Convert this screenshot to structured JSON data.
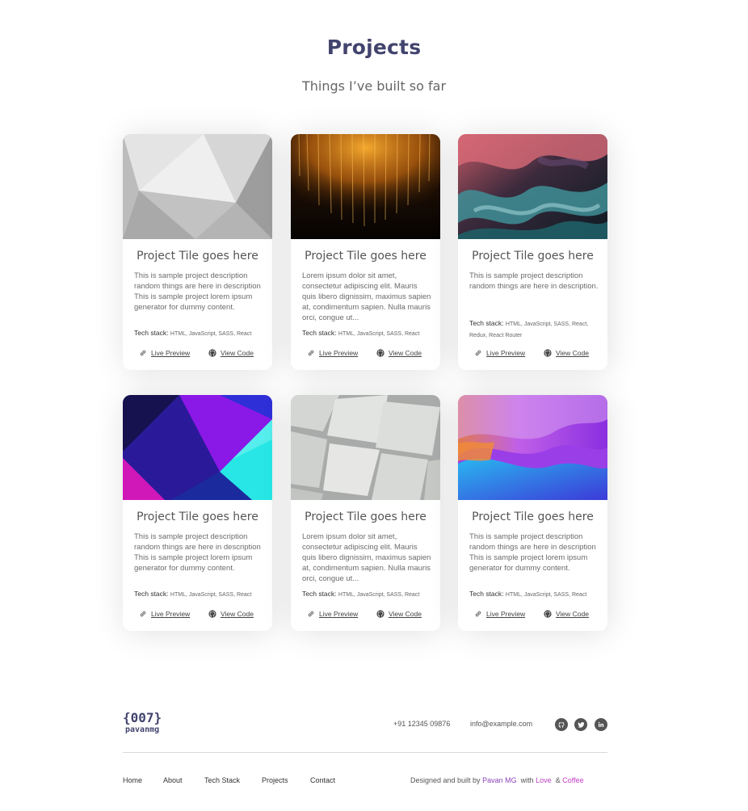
{
  "section": {
    "title": "Projects",
    "subtitle": "Things I’ve built so far"
  },
  "projects": [
    {
      "title": "Project Tile goes here",
      "description": "This is sample project description random things are here in description This is sample project lorem ipsum generator for dummy content.",
      "stack_label": "Tech stack:",
      "stack": "HTML, JavaScript, SASS, React",
      "live_label": "Live Preview",
      "code_label": "View Code",
      "image": "grey-geometric-image"
    },
    {
      "title": "Project Tile goes here",
      "description": "Lorem ipsum dolor sit amet, consectetur adipiscing elit. Mauris quis libero dignissim, maximus sapien at, condimentum sapien. Nulla mauris orci, congue ut...",
      "stack_label": "Tech stack:",
      "stack": "HTML, JavaScript, SASS, React",
      "live_label": "Live Preview",
      "code_label": "View Code",
      "image": "golden-light-streaks-image"
    },
    {
      "title": "Project Tile goes here",
      "description": "This is sample project description random things are here in description.",
      "stack_label": "Tech stack:",
      "stack": "HTML, JavaScript, SASS, React, Redux, React Router",
      "live_label": "Live Preview",
      "code_label": "View Code",
      "image": "colorful-smoke-image"
    },
    {
      "title": "Project Tile goes here",
      "description": "This is sample project description random things are here in description This is sample project lorem ipsum generator for dummy content.",
      "stack_label": "Tech stack:",
      "stack": "HTML, JavaScript, SASS, React",
      "live_label": "Live Preview",
      "code_label": "View Code",
      "image": "neon-diamond-image"
    },
    {
      "title": "Project Tile goes here",
      "description": "Lorem ipsum dolor sit amet, consectetur adipiscing elit. Mauris quis libero dignissim, maximus sapien at, condimentum sapien. Nulla mauris orci, congue ut...",
      "stack_label": "Tech stack:",
      "stack": "HTML, JavaScript, SASS, React",
      "live_label": "Live Preview",
      "code_label": "View Code",
      "image": "paper-sheets-image"
    },
    {
      "title": "Project Tile goes here",
      "description": "This is sample project description random things are here in description This is sample project lorem ipsum generator for dummy content.",
      "stack_label": "Tech stack:",
      "stack": "HTML, JavaScript, SASS, React",
      "live_label": "Live Preview",
      "code_label": "View Code",
      "image": "purple-blue-waves-image"
    }
  ],
  "footer": {
    "logo_mark": "{007}",
    "logo_name": "pavanmg",
    "phone": "+91 12345 09876",
    "email": "info@example.com",
    "social": [
      "github-icon",
      "twitter-icon",
      "linkedin-icon"
    ],
    "nav": [
      "Home",
      "About",
      "Tech Stack",
      "Projects",
      "Contact"
    ],
    "credits": {
      "prefix": "Designed and built by",
      "name": "Pavan MG",
      "with": "with",
      "love": "Love",
      "amp": "&",
      "coffee": "Coffee"
    }
  },
  "colors": {
    "heading": "#42446e",
    "text": "#666666",
    "accent": "#8b44b8"
  }
}
